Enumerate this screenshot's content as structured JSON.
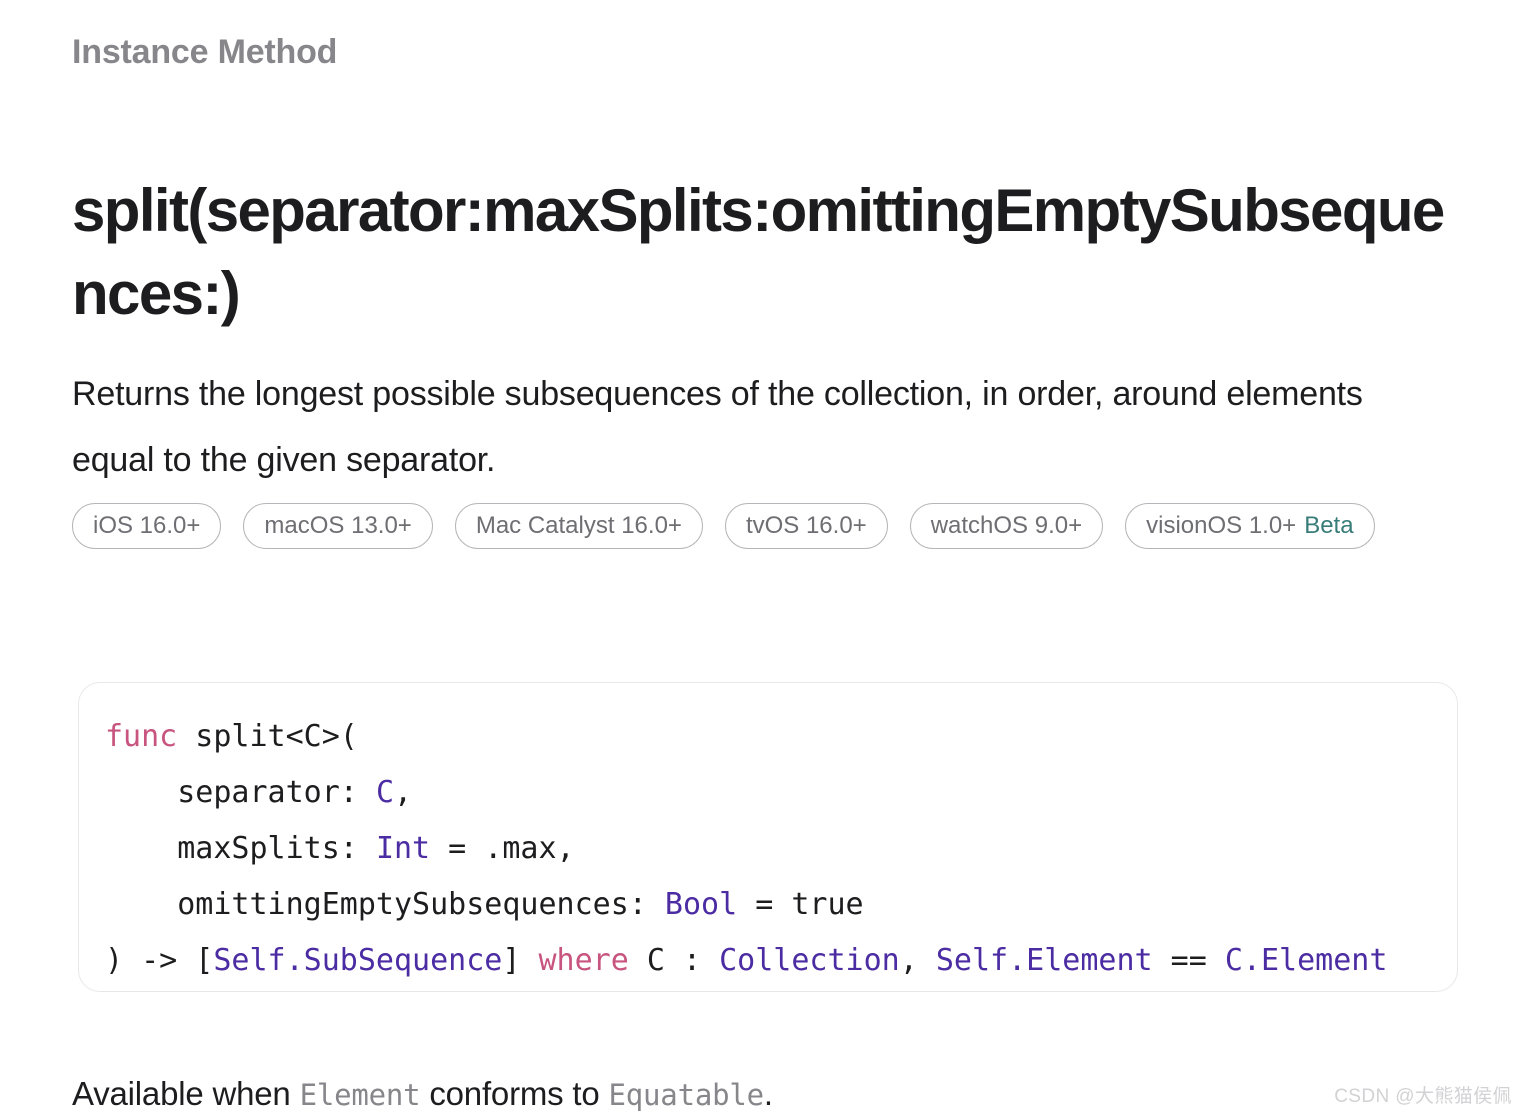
{
  "page": {
    "eyebrow": "Instance Method",
    "title": "split(separator:maxSplits:omittingEmptySubsequences:)",
    "abstract": "Returns the longest possible subsequences of the collection, in order, around elements equal to the given separator."
  },
  "availability": {
    "items": [
      {
        "label": "iOS 16.0+",
        "beta": ""
      },
      {
        "label": "macOS 13.0+",
        "beta": ""
      },
      {
        "label": "Mac Catalyst 16.0+",
        "beta": ""
      },
      {
        "label": "tvOS 16.0+",
        "beta": ""
      },
      {
        "label": "watchOS 9.0+",
        "beta": ""
      },
      {
        "label": "visionOS 1.0+",
        "beta": "Beta"
      }
    ],
    "beta_color": "#377c78",
    "border_color": "#b6b6ba",
    "text_color": "#6e6e73"
  },
  "declaration": {
    "keyword_color": "#c7557f",
    "type_color": "#4b2ca3",
    "border_color": "#e8e8ea",
    "lines": [
      {
        "id": "line-1",
        "tokens": [
          {
            "text": "func",
            "style": "kw"
          },
          {
            "text": " split<C>(",
            "style": "plain"
          }
        ]
      },
      {
        "id": "line-2",
        "tokens": [
          {
            "text": "    separator: ",
            "style": "plain"
          },
          {
            "text": "C",
            "style": "type"
          },
          {
            "text": ",",
            "style": "plain"
          }
        ]
      },
      {
        "id": "line-3",
        "tokens": [
          {
            "text": "    maxSplits: ",
            "style": "plain"
          },
          {
            "text": "Int",
            "style": "type"
          },
          {
            "text": " = .max,",
            "style": "plain"
          }
        ]
      },
      {
        "id": "line-4",
        "tokens": [
          {
            "text": "    omittingEmptySubsequences: ",
            "style": "plain"
          },
          {
            "text": "Bool",
            "style": "type"
          },
          {
            "text": " = true",
            "style": "plain"
          }
        ]
      },
      {
        "id": "line-5",
        "tokens": [
          {
            "text": ") -> [",
            "style": "plain"
          },
          {
            "text": "Self.SubSequence",
            "style": "type"
          },
          {
            "text": "] ",
            "style": "plain"
          },
          {
            "text": "where",
            "style": "kw"
          },
          {
            "text": " C : ",
            "style": "plain"
          },
          {
            "text": "Collection",
            "style": "type"
          },
          {
            "text": ", ",
            "style": "plain"
          },
          {
            "text": "Self.Element",
            "style": "type"
          },
          {
            "text": " == ",
            "style": "plain"
          },
          {
            "text": "C.Element",
            "style": "type"
          }
        ]
      }
    ]
  },
  "conformance": {
    "prefix": "Available when ",
    "code_a": "Element",
    "middle": " conforms to ",
    "code_b": "Equatable",
    "suffix": "."
  },
  "watermark": {
    "text": "CSDN @大熊猫侯佩"
  }
}
